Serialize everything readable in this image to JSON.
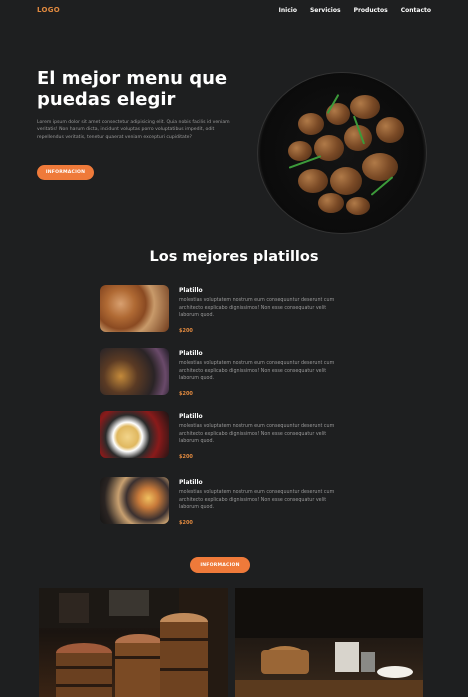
{
  "nav": {
    "logo": "LOGO",
    "items": [
      "Inicio",
      "Servicios",
      "Productos",
      "Contacto"
    ]
  },
  "hero": {
    "title": "El mejor menu que puedas elegir",
    "text": "Lorem ipsum dolor sit amet consectetur adipisicing elit. Quia nobis facilis id veniam veritatis! Non harum dicta, incidunt voluptas porro voluptatibus impedit, odit repellendus veritatis, tenetur quaerat veniam excepturi cupiditate?",
    "button": "INFORMACION"
  },
  "section": {
    "title": "Los mejores platillos"
  },
  "dishes": [
    {
      "name": "Platillo",
      "desc": "molestias voluptatem nostrum eum consequuntur deserunt cum architecto explicabo dignissimos! Non esse consequatur velit laborum quod.",
      "price": "$200"
    },
    {
      "name": "Platillo",
      "desc": "molestias voluptatem nostrum eum consequuntur deserunt cum architecto explicabo dignissimos! Non esse consequatur velit laborum quod.",
      "price": "$200"
    },
    {
      "name": "Platillo",
      "desc": "molestias voluptatem nostrum eum consequuntur deserunt cum architecto explicabo dignissimos! Non esse consequatur velit laborum quod.",
      "price": "$200"
    },
    {
      "name": "Platillo",
      "desc": "molestias voluptatem nostrum eum consequuntur deserunt cum architecto explicabo dignissimos! Non esse consequatur velit laborum quod.",
      "price": "$200"
    }
  ],
  "cta": {
    "button": "INFORMACION"
  },
  "colors": {
    "background": "#1e1f20",
    "accent": "#ef7a3a",
    "price": "#e0893f"
  }
}
